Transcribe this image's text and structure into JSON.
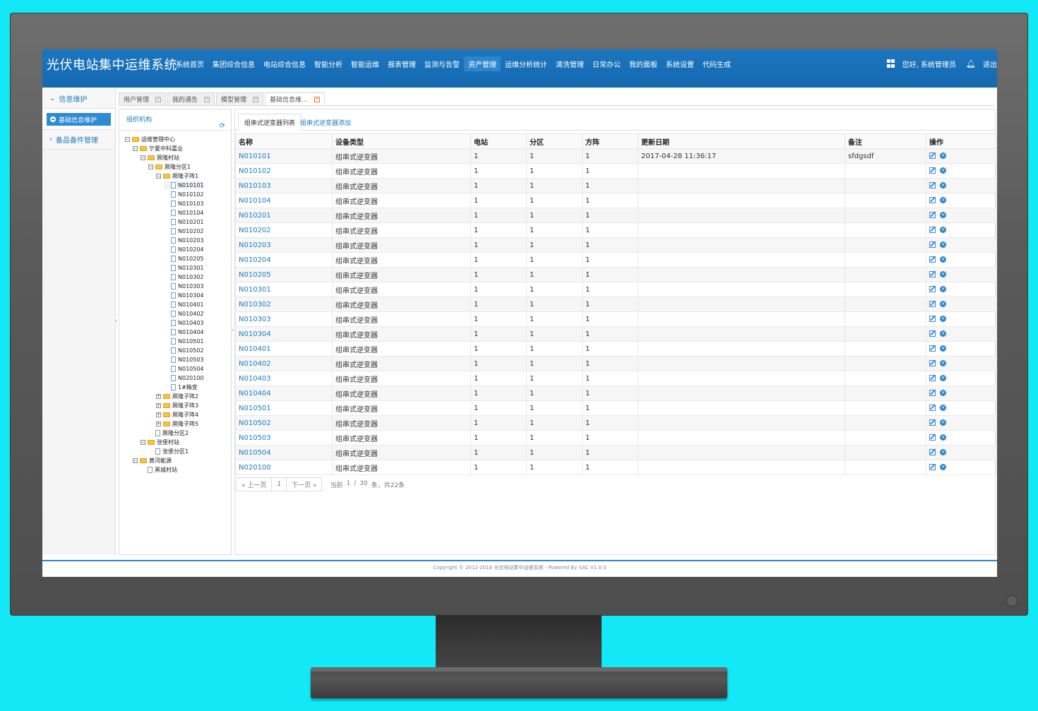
{
  "app": {
    "title": "光伏电站集中运维系统"
  },
  "nav": {
    "items": [
      "系统首页",
      "集团综合信息",
      "电站综合信息",
      "智能分析",
      "智能运维",
      "报表管理",
      "监测与告警",
      "资产管理",
      "运维分析统计",
      "清洗管理",
      "日常办公",
      "我的面板",
      "系统设置",
      "代码生成"
    ],
    "active_index": 7,
    "greeting": "您好, 系统管理员",
    "logout": "退出"
  },
  "left_menu": {
    "section1": "信息维护",
    "section1_sub": "基础信息维护",
    "section2": "备品备件管理"
  },
  "tabs": [
    "用户管理",
    "我的通告",
    "模型管理",
    "基础信息维..."
  ],
  "org": {
    "title": "组织机构",
    "tree": [
      {
        "label": "运维管理中心",
        "level": 0,
        "kind": "folder",
        "tog": "⊟"
      },
      {
        "label": "宁夏中科嘉业",
        "level": 1,
        "kind": "folder",
        "tog": "⊟"
      },
      {
        "label": "厥隆村站",
        "level": 2,
        "kind": "folder",
        "tog": "⊟"
      },
      {
        "label": "厥隆分区1",
        "level": 3,
        "kind": "folder",
        "tog": "⊟"
      },
      {
        "label": "厥隆子阵1",
        "level": 4,
        "kind": "folder",
        "tog": "⊟"
      },
      {
        "label": "N010101",
        "level": 5,
        "kind": "doc",
        "sel": true
      },
      {
        "label": "N010102",
        "level": 5,
        "kind": "doc"
      },
      {
        "label": "N010103",
        "level": 5,
        "kind": "doc"
      },
      {
        "label": "N010104",
        "level": 5,
        "kind": "doc"
      },
      {
        "label": "N010201",
        "level": 5,
        "kind": "doc"
      },
      {
        "label": "N010202",
        "level": 5,
        "kind": "doc"
      },
      {
        "label": "N010203",
        "level": 5,
        "kind": "doc"
      },
      {
        "label": "N010204",
        "level": 5,
        "kind": "doc"
      },
      {
        "label": "N010205",
        "level": 5,
        "kind": "doc"
      },
      {
        "label": "N010301",
        "level": 5,
        "kind": "doc"
      },
      {
        "label": "N010302",
        "level": 5,
        "kind": "doc"
      },
      {
        "label": "N010303",
        "level": 5,
        "kind": "doc"
      },
      {
        "label": "N010304",
        "level": 5,
        "kind": "doc"
      },
      {
        "label": "N010401",
        "level": 5,
        "kind": "doc"
      },
      {
        "label": "N010402",
        "level": 5,
        "kind": "doc"
      },
      {
        "label": "N010403",
        "level": 5,
        "kind": "doc"
      },
      {
        "label": "N010404",
        "level": 5,
        "kind": "doc"
      },
      {
        "label": "N010501",
        "level": 5,
        "kind": "doc"
      },
      {
        "label": "N010502",
        "level": 5,
        "kind": "doc"
      },
      {
        "label": "N010503",
        "level": 5,
        "kind": "doc"
      },
      {
        "label": "N010504",
        "level": 5,
        "kind": "doc"
      },
      {
        "label": "N020100",
        "level": 5,
        "kind": "doc"
      },
      {
        "label": "1#箱变",
        "level": 5,
        "kind": "doc"
      },
      {
        "label": "厥隆子阵2",
        "level": 4,
        "kind": "folder",
        "tog": "⊞"
      },
      {
        "label": "厥隆子阵3",
        "level": 4,
        "kind": "folder",
        "tog": "⊞"
      },
      {
        "label": "厥隆子阵4",
        "level": 4,
        "kind": "folder",
        "tog": "⊞"
      },
      {
        "label": "厥隆子阵5",
        "level": 4,
        "kind": "folder",
        "tog": "⊞"
      },
      {
        "label": "厥隆分区2",
        "level": 3,
        "kind": "doc"
      },
      {
        "label": "张堡村站",
        "level": 2,
        "kind": "folder",
        "tog": "⊟"
      },
      {
        "label": "张堡分区1",
        "level": 3,
        "kind": "doc"
      },
      {
        "label": "黄河能源",
        "level": 1,
        "kind": "folder",
        "tog": "⊟"
      },
      {
        "label": "黑城村站",
        "level": 2,
        "kind": "doc"
      }
    ]
  },
  "content": {
    "subtabs": [
      "组串式逆变器列表",
      "组串式逆变器添加"
    ],
    "columns": [
      "名称",
      "设备类型",
      "电站",
      "分区",
      "方阵",
      "更新日期",
      "备注",
      "操作"
    ],
    "rows": [
      [
        "N010101",
        "组串式逆变器",
        "1",
        "1",
        "1",
        "2017-04-28 11:36:17",
        "sfdgsdf"
      ],
      [
        "N010102",
        "组串式逆变器",
        "1",
        "1",
        "1",
        "",
        ""
      ],
      [
        "N010103",
        "组串式逆变器",
        "1",
        "1",
        "1",
        "",
        ""
      ],
      [
        "N010104",
        "组串式逆变器",
        "1",
        "1",
        "1",
        "",
        ""
      ],
      [
        "N010201",
        "组串式逆变器",
        "1",
        "1",
        "1",
        "",
        ""
      ],
      [
        "N010202",
        "组串式逆变器",
        "1",
        "1",
        "1",
        "",
        ""
      ],
      [
        "N010203",
        "组串式逆变器",
        "1",
        "1",
        "1",
        "",
        ""
      ],
      [
        "N010204",
        "组串式逆变器",
        "1",
        "1",
        "1",
        "",
        ""
      ],
      [
        "N010205",
        "组串式逆变器",
        "1",
        "1",
        "1",
        "",
        ""
      ],
      [
        "N010301",
        "组串式逆变器",
        "1",
        "1",
        "1",
        "",
        ""
      ],
      [
        "N010302",
        "组串式逆变器",
        "1",
        "1",
        "1",
        "",
        ""
      ],
      [
        "N010303",
        "组串式逆变器",
        "1",
        "1",
        "1",
        "",
        ""
      ],
      [
        "N010304",
        "组串式逆变器",
        "1",
        "1",
        "1",
        "",
        ""
      ],
      [
        "N010401",
        "组串式逆变器",
        "1",
        "1",
        "1",
        "",
        ""
      ],
      [
        "N010402",
        "组串式逆变器",
        "1",
        "1",
        "1",
        "",
        ""
      ],
      [
        "N010403",
        "组串式逆变器",
        "1",
        "1",
        "1",
        "",
        ""
      ],
      [
        "N010404",
        "组串式逆变器",
        "1",
        "1",
        "1",
        "",
        ""
      ],
      [
        "N010501",
        "组串式逆变器",
        "1",
        "1",
        "1",
        "",
        ""
      ],
      [
        "N010502",
        "组串式逆变器",
        "1",
        "1",
        "1",
        "",
        ""
      ],
      [
        "N010503",
        "组串式逆变器",
        "1",
        "1",
        "1",
        "",
        ""
      ],
      [
        "N010504",
        "组串式逆变器",
        "1",
        "1",
        "1",
        "",
        ""
      ],
      [
        "N020100",
        "组串式逆变器",
        "1",
        "1",
        "1",
        "",
        ""
      ]
    ]
  },
  "pager": {
    "prev": "« 上一页",
    "page": "1",
    "next": "下一页 »",
    "current_label": "当前",
    "current_page": "1",
    "sep": "/",
    "page_size": "30",
    "total_text": "条，共22条"
  },
  "footer": {
    "text": "Copyright © 2012-2016 光伏电站集中运维系统 - Powered By SAC V1.0.0"
  },
  "icons": {
    "left_menu_section1": "chevron-down-icon",
    "left_menu_section2": "chevron-right-icon",
    "org_refresh": "refresh-icon",
    "row_edit": "edit-icon",
    "row_delete": "delete-icon",
    "top_apps": "apps-grid-icon",
    "top_bell": "bell-icon"
  },
  "colors": {
    "accent": "#1b7dc1",
    "header": "#1b76bf",
    "page_bg": "#13e8f7"
  }
}
